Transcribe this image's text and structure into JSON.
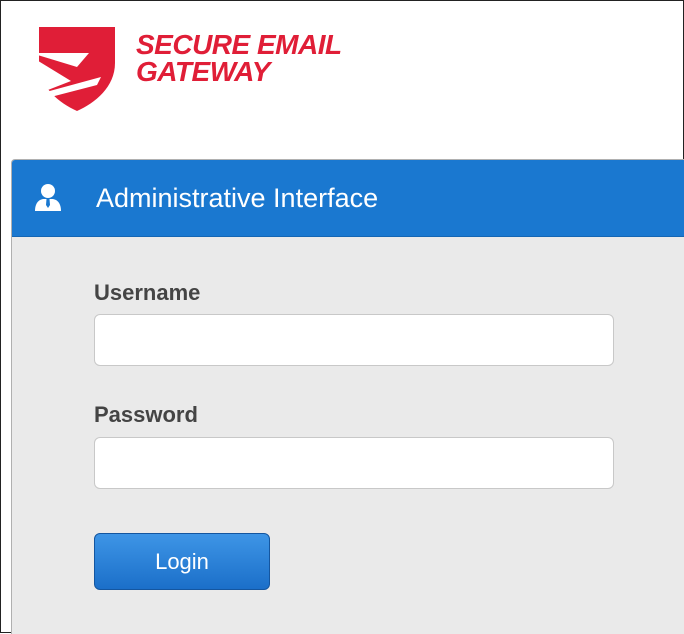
{
  "brand": {
    "logo_line1": "SECURE EMAIL",
    "logo_line2": "GATEWAY",
    "logo_icon": "shield-envelope-icon",
    "brand_color": "#e01e37"
  },
  "login_panel": {
    "title": "Administrative Interface",
    "header_icon": "user-icon",
    "header_color": "#1a78d0",
    "username_label": "Username",
    "username_value": "",
    "password_label": "Password",
    "password_value": "",
    "login_label": "Login"
  }
}
